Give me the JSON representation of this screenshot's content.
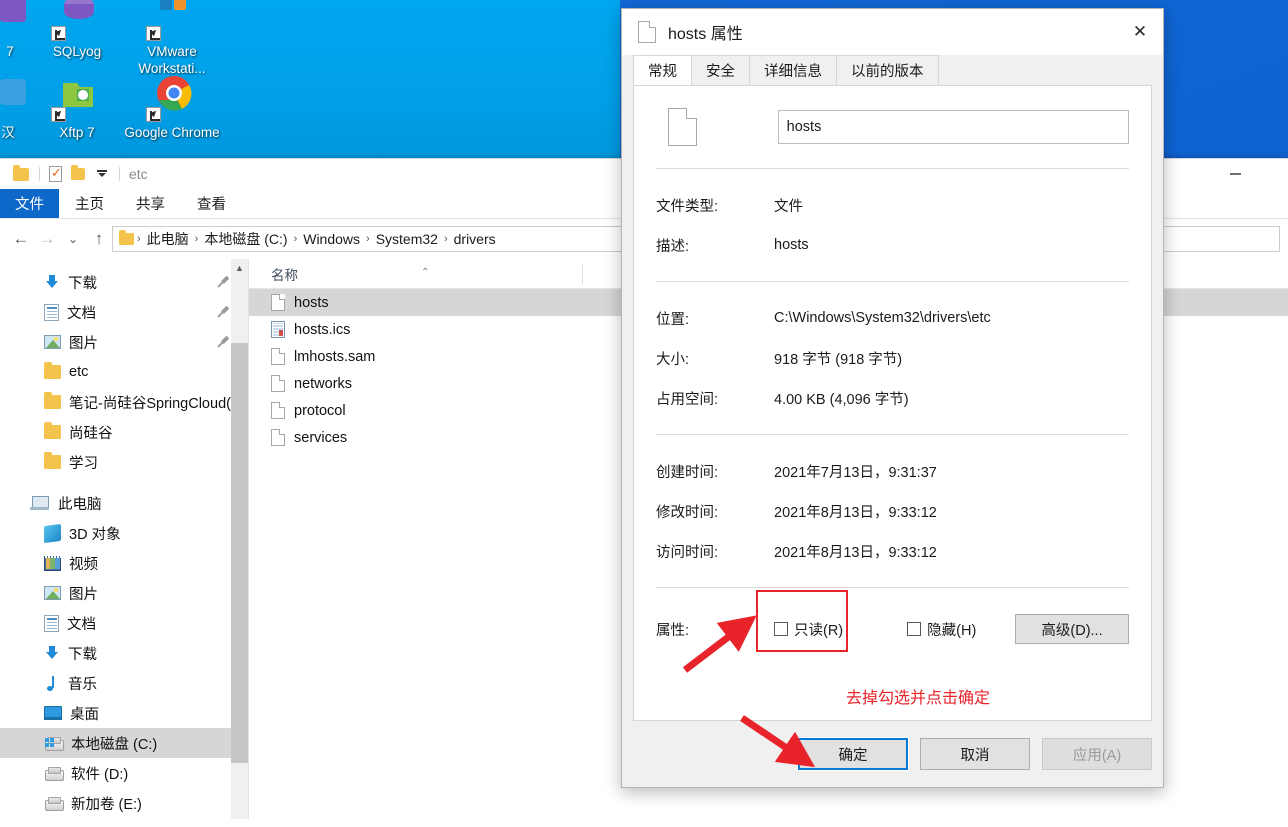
{
  "desktop": {
    "icons": [
      {
        "label": "7",
        "name": "desktop-icon-partial-left"
      },
      {
        "label": "SQLyog",
        "name": "desktop-icon-sqlyog"
      },
      {
        "label": "VMware Workstati...",
        "name": "desktop-icon-vmware"
      },
      {
        "label": "汉",
        "name": "desktop-icon-partial-left2"
      },
      {
        "label": "Xftp 7",
        "name": "desktop-icon-xftp"
      },
      {
        "label": "Google Chrome",
        "name": "desktop-icon-chrome"
      }
    ],
    "background_color_left": "#00a0e8",
    "background_color_right": "#0b5fce"
  },
  "explorer": {
    "title": "etc",
    "quick_access": [
      "folder-icon",
      "properties-icon",
      "new-folder-icon",
      "chevron-down-icon"
    ],
    "minimize_label": "—",
    "ribbon_tabs": [
      {
        "label": "文件",
        "active": true
      },
      {
        "label": "主页",
        "active": false
      },
      {
        "label": "共享",
        "active": false
      },
      {
        "label": "查看",
        "active": false
      }
    ],
    "nav_buttons": {
      "back": "←",
      "forward": "→",
      "recent": "⌄",
      "up": "↑"
    },
    "breadcrumb": [
      "此电脑",
      "本地磁盘 (C:)",
      "Windows",
      "System32",
      "drivers"
    ],
    "breadcrumb_separator": "›",
    "nav_pane": [
      {
        "label": "下载",
        "icon": "download-icon",
        "pinned": true,
        "indent": 1,
        "selected": false
      },
      {
        "label": "文档",
        "icon": "documents-icon",
        "pinned": true,
        "indent": 1,
        "selected": false
      },
      {
        "label": "图片",
        "icon": "pictures-icon",
        "pinned": true,
        "indent": 1,
        "selected": false
      },
      {
        "label": "etc",
        "icon": "folder-icon",
        "pinned": false,
        "indent": 1,
        "selected": false
      },
      {
        "label": "笔记-尚硅谷SpringCloud(H",
        "icon": "folder-icon",
        "pinned": false,
        "indent": 1,
        "selected": false
      },
      {
        "label": "尚硅谷",
        "icon": "folder-icon",
        "pinned": false,
        "indent": 1,
        "selected": false
      },
      {
        "label": "学习",
        "icon": "folder-icon",
        "pinned": false,
        "indent": 1,
        "selected": false
      },
      {
        "label": "此电脑",
        "icon": "this-pc-icon",
        "pinned": false,
        "indent": 0,
        "selected": false
      },
      {
        "label": "3D 对象",
        "icon": "3d-objects-icon",
        "pinned": false,
        "indent": 1,
        "selected": false
      },
      {
        "label": "视频",
        "icon": "videos-icon",
        "pinned": false,
        "indent": 1,
        "selected": false
      },
      {
        "label": "图片",
        "icon": "pictures-icon",
        "pinned": false,
        "indent": 1,
        "selected": false
      },
      {
        "label": "文档",
        "icon": "documents-icon",
        "pinned": false,
        "indent": 1,
        "selected": false
      },
      {
        "label": "下载",
        "icon": "download-icon",
        "pinned": false,
        "indent": 1,
        "selected": false
      },
      {
        "label": "音乐",
        "icon": "music-icon",
        "pinned": false,
        "indent": 1,
        "selected": false
      },
      {
        "label": "桌面",
        "icon": "desktop-icon",
        "pinned": false,
        "indent": 1,
        "selected": false
      },
      {
        "label": "本地磁盘 (C:)",
        "icon": "drive-c-icon",
        "pinned": false,
        "indent": 1,
        "selected": true
      },
      {
        "label": "软件 (D:)",
        "icon": "drive-icon",
        "pinned": false,
        "indent": 1,
        "selected": false
      },
      {
        "label": "新加卷 (E:)",
        "icon": "drive-icon",
        "pinned": false,
        "indent": 1,
        "selected": false
      }
    ],
    "file_list": {
      "column_header": "名称",
      "sort_indicator": "⌃",
      "rows": [
        {
          "name": "hosts",
          "icon": "file-blank-icon",
          "selected": true
        },
        {
          "name": "hosts.ics",
          "icon": "calendar-file-icon",
          "selected": false
        },
        {
          "name": "lmhosts.sam",
          "icon": "file-blank-icon",
          "selected": false
        },
        {
          "name": "networks",
          "icon": "file-blank-icon",
          "selected": false
        },
        {
          "name": "protocol",
          "icon": "file-blank-icon",
          "selected": false
        },
        {
          "name": "services",
          "icon": "file-blank-icon",
          "selected": false
        }
      ]
    }
  },
  "dialog": {
    "title": "hosts 属性",
    "close_label": "✕",
    "tabs": [
      {
        "label": "常规",
        "active": true
      },
      {
        "label": "安全",
        "active": false
      },
      {
        "label": "详细信息",
        "active": false
      },
      {
        "label": "以前的版本",
        "active": false
      }
    ],
    "filename_value": "hosts",
    "fields": [
      {
        "label": "文件类型:",
        "value": "文件"
      },
      {
        "label": "描述:",
        "value": "hosts"
      },
      {
        "label": "位置:",
        "value": "C:\\Windows\\System32\\drivers\\etc"
      },
      {
        "label": "大小:",
        "value": "918 字节 (918 字节)"
      },
      {
        "label": "占用空间:",
        "value": "4.00 KB (4,096 字节)"
      },
      {
        "label": "创建时间:",
        "value": "2021年7月13日，9:31:37"
      },
      {
        "label": "修改时间:",
        "value": "2021年8月13日，9:33:12"
      },
      {
        "label": "访问时间:",
        "value": "2021年8月13日，9:33:12"
      }
    ],
    "attributes": {
      "label": "属性:",
      "readonly_label": "只读(R)",
      "readonly_checked": false,
      "hidden_label": "隐藏(H)",
      "hidden_checked": false,
      "advanced_label": "高级(D)..."
    },
    "buttons": [
      {
        "label": "确定",
        "state": "default-focused"
      },
      {
        "label": "取消",
        "state": "normal"
      },
      {
        "label": "应用(A)",
        "state": "disabled"
      }
    ]
  },
  "annotation": {
    "text": "去掉勾选并点击确定",
    "color": "#e8232a"
  }
}
